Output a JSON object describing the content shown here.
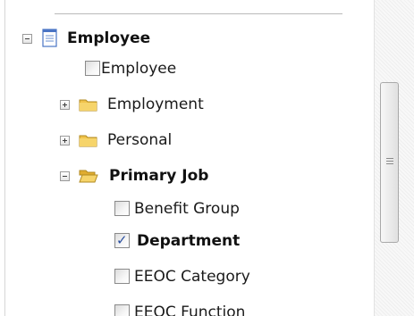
{
  "tree": {
    "root": {
      "label": "Employee",
      "expanded": true,
      "icon": "document-icon"
    },
    "items": [
      {
        "type": "checkbox",
        "label": "Employee",
        "checked": false,
        "bold": false
      },
      {
        "type": "folder",
        "label": "Employment",
        "expanded": false
      },
      {
        "type": "folder",
        "label": "Personal",
        "expanded": false
      },
      {
        "type": "folder",
        "label": "Primary Job",
        "expanded": true,
        "bold": true
      },
      {
        "type": "checkbox",
        "label": "Benefit Group",
        "checked": false,
        "bold": false
      },
      {
        "type": "checkbox",
        "label": "Department",
        "checked": true,
        "bold": true
      },
      {
        "type": "checkbox",
        "label": "EEOC Category",
        "checked": false,
        "bold": false
      },
      {
        "type": "checkbox",
        "label": "EEOC Function",
        "checked": false,
        "bold": false
      }
    ]
  },
  "colors": {
    "check": "#2a4fa0",
    "folder": "#f0c24a"
  }
}
